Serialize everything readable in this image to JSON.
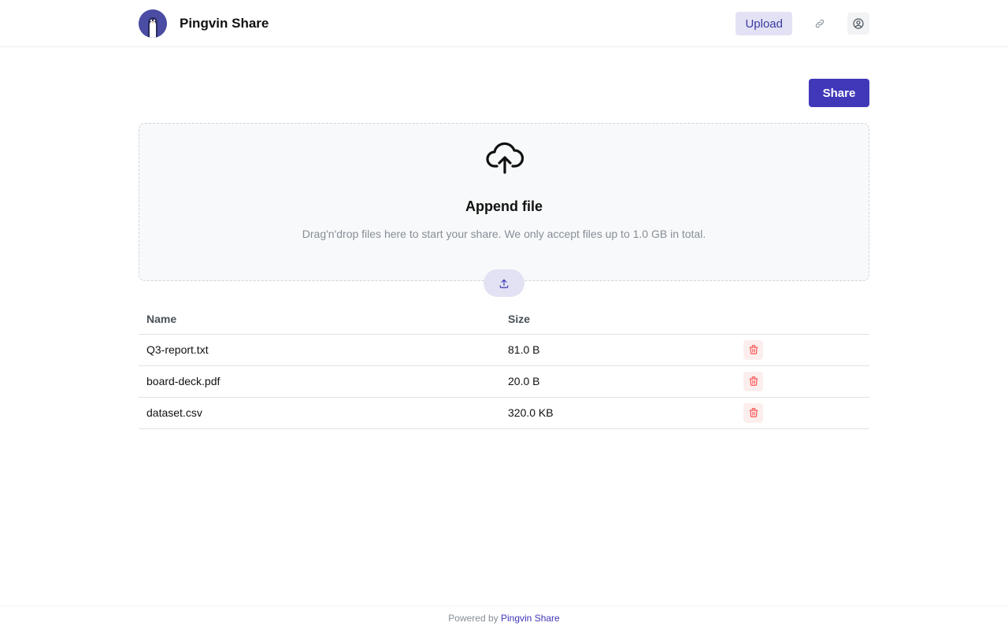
{
  "header": {
    "brand_name": "Pingvin Share",
    "upload_label": "Upload",
    "icons": {
      "link": "link-icon",
      "user": "user-circle-icon"
    }
  },
  "actions": {
    "share_label": "Share"
  },
  "dropzone": {
    "title": "Append file",
    "description": "Drag'n'drop files here to start your share. We only accept files up to 1.0 GB in total.",
    "icon": "cloud-upload-icon",
    "upload_icon": "upload-icon"
  },
  "table": {
    "columns": [
      "Name",
      "Size"
    ],
    "rows": [
      {
        "name": "Q3-report.txt",
        "size": "81.0 B"
      },
      {
        "name": "board-deck.pdf",
        "size": "20.0 B"
      },
      {
        "name": "dataset.csv",
        "size": "320.0 KB"
      }
    ]
  },
  "footer": {
    "prefix": "Powered by",
    "link_text": "Pingvin Share"
  },
  "colors": {
    "accent": "#4038b8",
    "accent_light": "#e3e2f5",
    "danger": "#fa5252"
  }
}
